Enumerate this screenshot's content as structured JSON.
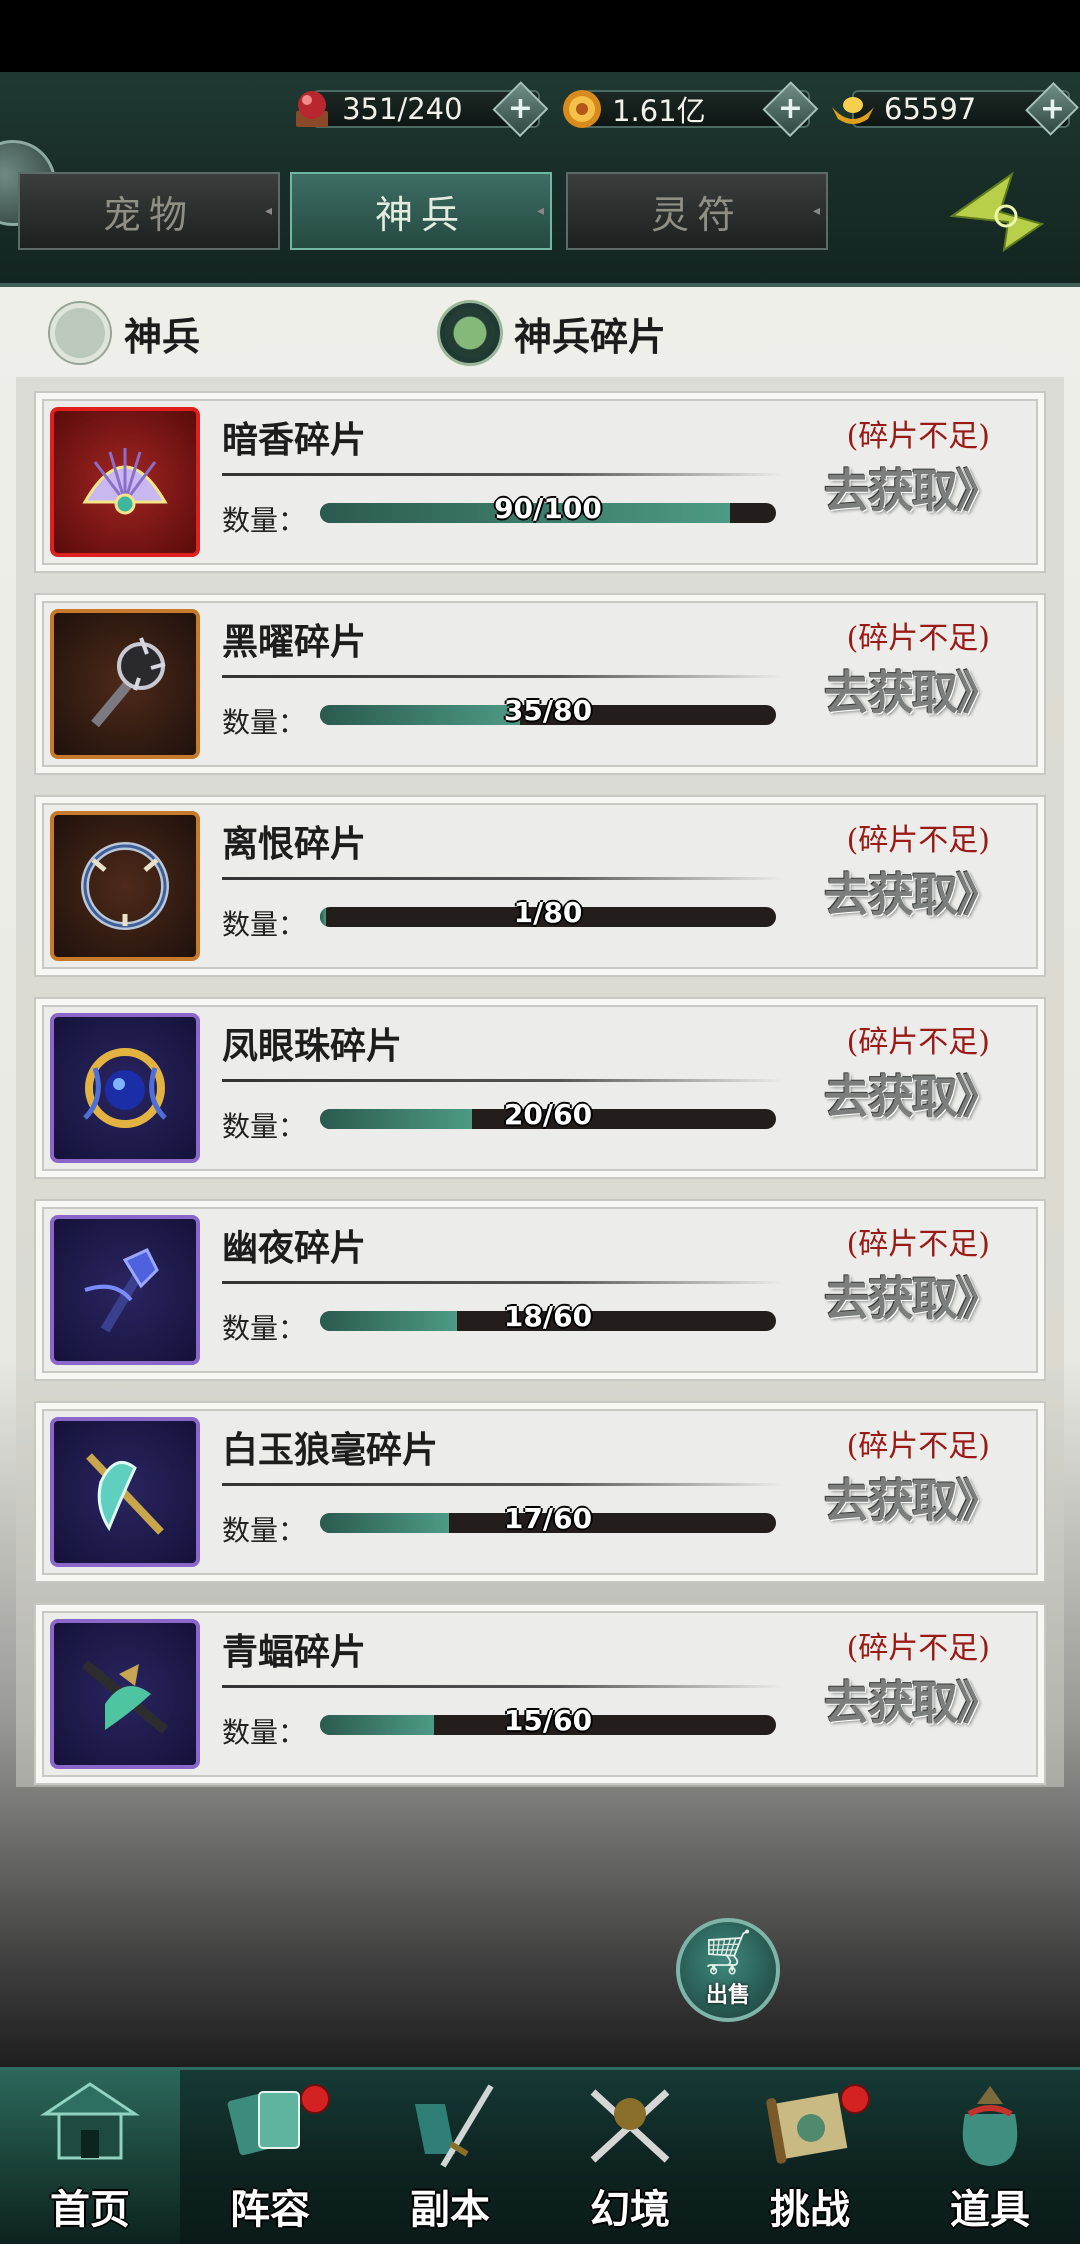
{
  "colors": {
    "header_bg": "#1f3a33",
    "accent_teal": "#4d9a85",
    "shortage_red": "#9a1a16",
    "badge_red": "#d42121"
  },
  "resources": [
    {
      "icon": "red-orb-icon",
      "value": "351/240"
    },
    {
      "icon": "gold-coin-icon",
      "value": "1.61亿"
    },
    {
      "icon": "gold-ingot-icon",
      "value": "65597"
    }
  ],
  "tabs": [
    {
      "label": "宠物",
      "active": false
    },
    {
      "label": "神兵",
      "active": true
    },
    {
      "label": "灵符",
      "active": false
    }
  ],
  "filters": [
    {
      "label": "神兵",
      "selected": false
    },
    {
      "label": "神兵碎片",
      "selected": true
    }
  ],
  "quantity_label": "数量：",
  "shortage_text": "(碎片不足)",
  "get_button": "去获取》",
  "items": [
    {
      "name": "暗香碎片",
      "progress": "90/100",
      "current": 90,
      "total": 100,
      "rarity": "red"
    },
    {
      "name": "黑曜碎片",
      "progress": "35/80",
      "current": 35,
      "total": 80,
      "rarity": "orange"
    },
    {
      "name": "离恨碎片",
      "progress": "1/80",
      "current": 1,
      "total": 80,
      "rarity": "orange"
    },
    {
      "name": "凤眼珠碎片",
      "progress": "20/60",
      "current": 20,
      "total": 60,
      "rarity": "purple"
    },
    {
      "name": "幽夜碎片",
      "progress": "18/60",
      "current": 18,
      "total": 60,
      "rarity": "purple"
    },
    {
      "name": "白玉狼毫碎片",
      "progress": "17/60",
      "current": 17,
      "total": 60,
      "rarity": "purple"
    },
    {
      "name": "青蝠碎片",
      "progress": "15/60",
      "current": 15,
      "total": 60,
      "rarity": "purple"
    }
  ],
  "sell_button": "出售",
  "nav": [
    {
      "label": "首页",
      "icon": "pavilion-icon",
      "badge": false
    },
    {
      "label": "阵容",
      "icon": "cards-icon",
      "badge": true
    },
    {
      "label": "副本",
      "icon": "sword-icon",
      "badge": false
    },
    {
      "label": "幻境",
      "icon": "crossed-swords-icon",
      "badge": false
    },
    {
      "label": "挑战",
      "icon": "scroll-icon",
      "badge": true
    },
    {
      "label": "道具",
      "icon": "bag-icon",
      "badge": false
    }
  ]
}
